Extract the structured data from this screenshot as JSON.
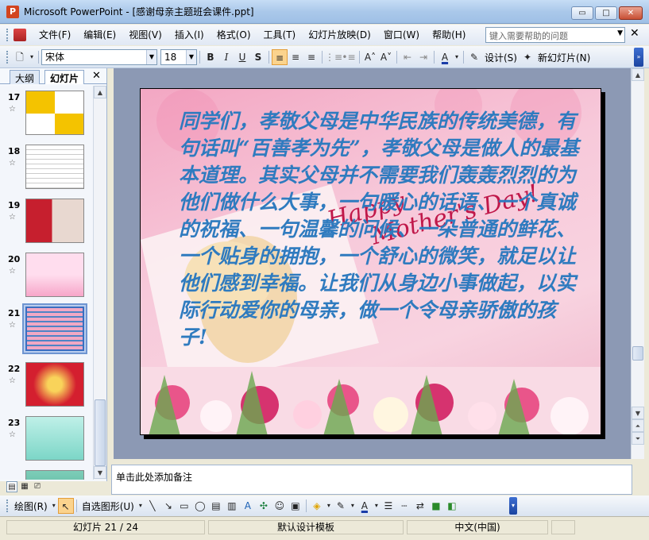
{
  "window": {
    "title": "Microsoft PowerPoint - [感谢母亲主题班会课件.ppt]",
    "min": "▭",
    "max": "□",
    "close": "✕"
  },
  "menu": {
    "items": [
      "文件(F)",
      "编辑(E)",
      "视图(V)",
      "插入(I)",
      "格式(O)",
      "工具(T)",
      "幻灯片放映(D)",
      "窗口(W)",
      "帮助(H)"
    ],
    "help_placeholder": "键入需要帮助的问题"
  },
  "format_toolbar": {
    "font": "宋体",
    "size": "18",
    "design_label": "设计(S)",
    "new_slide_label": "新幻灯片(N)"
  },
  "left_pane": {
    "tab_outline": "大纲",
    "tab_slides": "幻灯片",
    "thumbnails": [
      {
        "num": "17"
      },
      {
        "num": "18"
      },
      {
        "num": "19"
      },
      {
        "num": "20"
      },
      {
        "num": "21"
      },
      {
        "num": "22"
      },
      {
        "num": "23"
      }
    ]
  },
  "slide": {
    "text": "同学们，孝敬父母是中华民族的传统美德，有句话叫“百善孝为先”，孝敬父母是做人的最基本道理。其实父母并不需要我们轰轰烈烈的为他们做什么大事，一句暖心的话语、一个真诚的祝福、一句温馨的问候、一朵普通的鲜花、一个贴身的拥抱，一个舒心的微笑，就足以让他们感到幸福。让我们从身边小事做起，以实际行动爱你的母亲，做一个令母亲骄傲的孩子!",
    "script_line1": "Happy",
    "script_line2": "Mother's Day!"
  },
  "notes": {
    "placeholder": "单击此处添加备注"
  },
  "draw_toolbar": {
    "draw_label": "绘图(R)",
    "autoshape_label": "自选图形(U)"
  },
  "status": {
    "slide_info": "幻灯片 21 / 24",
    "template": "默认设计模板",
    "language": "中文(中国)"
  },
  "colors": {
    "slide_text": "#2f7bbf",
    "script_text": "#c0184a",
    "accent": "#3a6ec1"
  }
}
